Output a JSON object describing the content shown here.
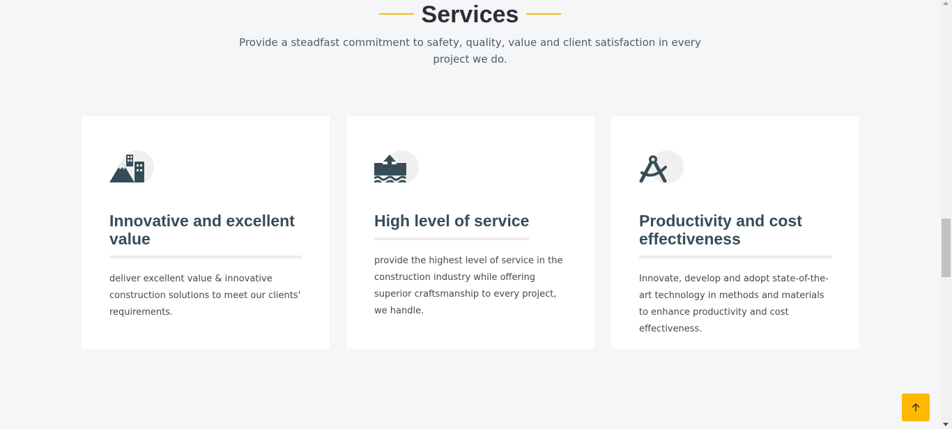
{
  "header": {
    "title": "Services",
    "subtitle": "Provide a steadfast commitment to safety, quality, value and client satisfaction in every project we do."
  },
  "services": [
    {
      "icon": "mountain-city-icon",
      "title": "Innovative and excellent value",
      "description": "deliver excellent value & innovative construction solutions to meet our clients' requirements."
    },
    {
      "icon": "arrow-up-from-water-pump-icon",
      "title": "High level of service",
      "description": "provide the highest level of service in the construction industry while offering superior craftsmanship to every project, we handle."
    },
    {
      "icon": "compass-drafting-icon",
      "title": "Productivity and cost effectiveness",
      "description": "Innovate, develop and adopt state-of-the-art technology in methods and materials to enhance productivity and cost effectiveness."
    }
  ],
  "scroll_top_icon": "arrow-up-icon",
  "colors": {
    "accent": "#feb900",
    "heading": "#364d59",
    "background": "#f4f6f8",
    "card": "#ffffff"
  }
}
